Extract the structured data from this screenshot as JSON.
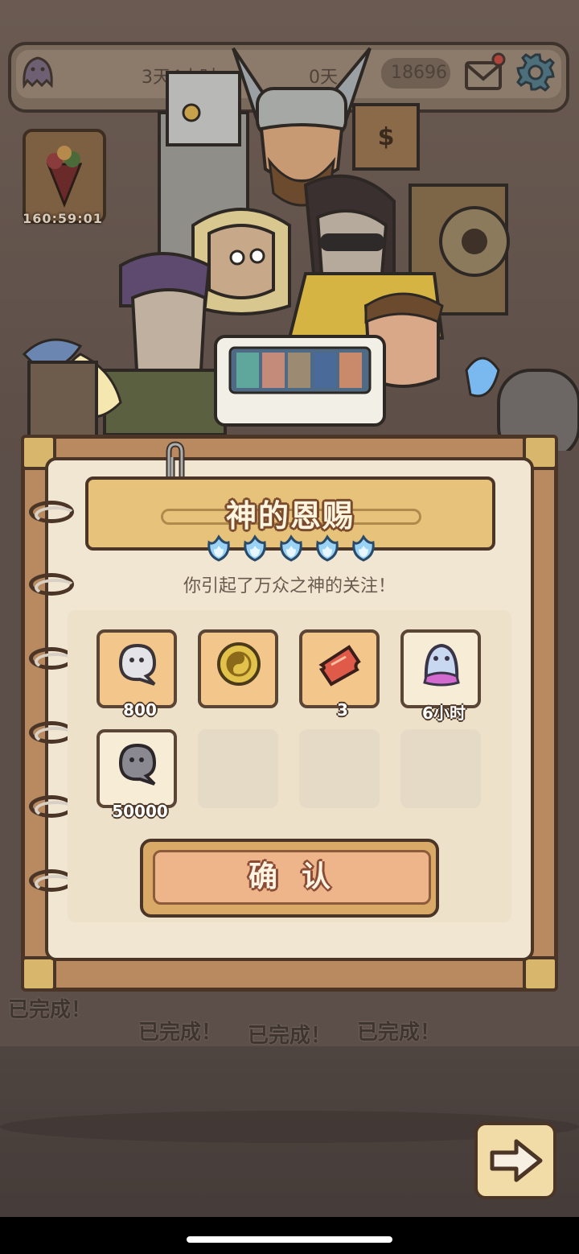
{
  "topbar": {
    "timer_text": "3天4小时",
    "mid_text": "0天",
    "currency": "18696"
  },
  "event": {
    "timer": "160:59:01"
  },
  "dialog": {
    "title": "神的恩赐",
    "subtitle": "你引起了万众之神的关注！",
    "flame_count": 5,
    "rewards": [
      {
        "icon": "soul-orb-icon",
        "qty": "800"
      },
      {
        "icon": "yin-yang-coin-icon",
        "qty": ""
      },
      {
        "icon": "ticket-icon",
        "qty": "3"
      },
      {
        "icon": "ghost-icon",
        "qty": "6小时"
      },
      {
        "icon": "dark-soul-orb-icon",
        "qty": "50000"
      }
    ],
    "confirm_label": "确认"
  },
  "background": {
    "done_labels": [
      "已完成！",
      "已完成！",
      "已完成！",
      "已完成！"
    ]
  },
  "colors": {
    "accent_gold": "#e6c27a",
    "panel_cream": "#f1e6d2",
    "button_orange": "#eeb48a",
    "outline_brown": "#4a3526"
  }
}
